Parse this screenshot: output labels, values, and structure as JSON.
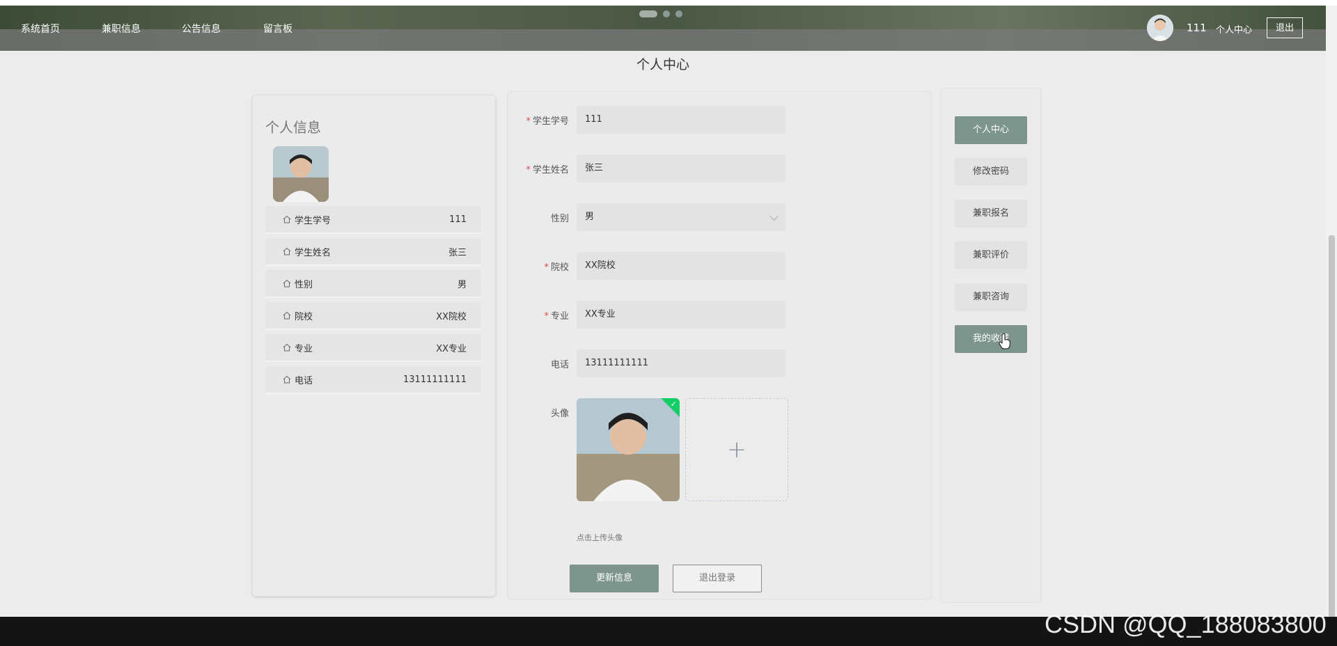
{
  "nav": {
    "items": [
      "系统首页",
      "兼职信息",
      "公告信息",
      "留言板"
    ],
    "user_name": "111",
    "center_link": "个人中心",
    "logout_label": "退出"
  },
  "page_title": "个人中心",
  "info_card": {
    "title": "个人信息",
    "rows": [
      {
        "label": "学生学号",
        "value": "111"
      },
      {
        "label": "学生姓名",
        "value": "张三"
      },
      {
        "label": "性别",
        "value": "男"
      },
      {
        "label": "院校",
        "value": "XX院校"
      },
      {
        "label": "专业",
        "value": "XX专业"
      },
      {
        "label": "电话",
        "value": "13111111111"
      }
    ]
  },
  "form": {
    "student_id": {
      "label": "学生学号",
      "value": "111",
      "required": true
    },
    "student_name": {
      "label": "学生姓名",
      "value": "张三",
      "required": true
    },
    "gender": {
      "label": "性别",
      "value": "男",
      "required": false
    },
    "school": {
      "label": "院校",
      "value": "XX院校",
      "required": true
    },
    "major": {
      "label": "专业",
      "value": "XX专业",
      "required": true
    },
    "phone": {
      "label": "电话",
      "value": "13111111111",
      "required": false
    },
    "avatar": {
      "label": "头像",
      "tip": "点击上传头像",
      "add_symbol": "+"
    },
    "update_button": "更新信息",
    "logout_button": "退出登录"
  },
  "side_menu": {
    "items": [
      {
        "label": "个人中心",
        "active": true
      },
      {
        "label": "修改密码",
        "active": false
      },
      {
        "label": "兼职报名",
        "active": false
      },
      {
        "label": "兼职评价",
        "active": false
      },
      {
        "label": "兼职咨询",
        "active": false
      },
      {
        "label": "我的收藏",
        "active": true
      }
    ]
  },
  "watermark": "CSDN @QQ_188083800",
  "colors": {
    "accent": "#7d958c",
    "required": "#e04a4a",
    "upload_success": "#13ce66"
  }
}
